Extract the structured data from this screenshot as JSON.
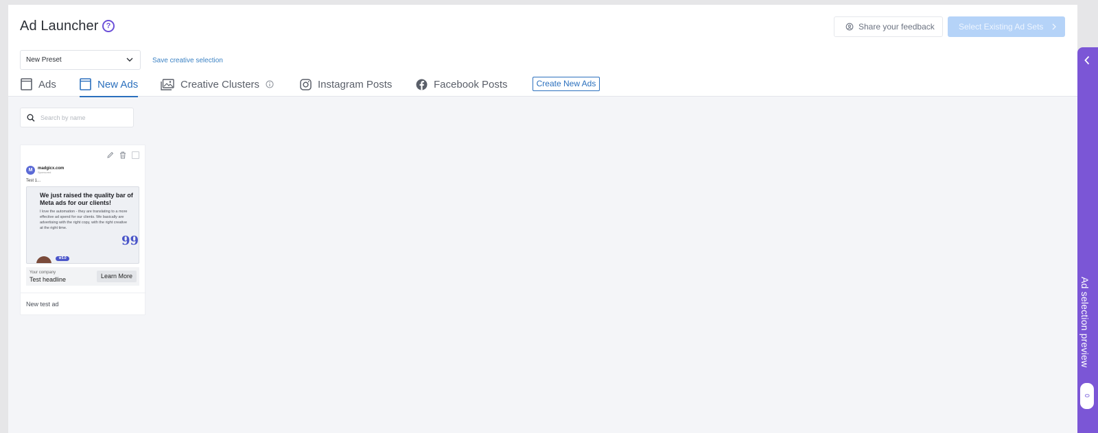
{
  "header": {
    "title": "Ad Launcher",
    "help_glyph": "?",
    "feedback_label": "Share your feedback",
    "select_label": "Select Existing Ad Sets"
  },
  "toolbar": {
    "preset_value": "New Preset",
    "save_link": "Save creative selection"
  },
  "tabs": [
    {
      "label": "Ads",
      "icon": "page-icon",
      "active": false
    },
    {
      "label": "New Ads",
      "icon": "page-icon",
      "active": true
    },
    {
      "label": "Creative Clusters",
      "icon": "image-gallery-icon",
      "active": false
    },
    {
      "label": "Instagram Posts",
      "icon": "instagram-icon",
      "active": false
    },
    {
      "label": "Facebook Posts",
      "icon": "facebook-icon",
      "active": false
    }
  ],
  "create_button": "Create New Ads",
  "search": {
    "placeholder": "Search by name"
  },
  "card": {
    "brand_logo": "M",
    "brand_name": "madgicx.com",
    "brand_sub": "Sponsored",
    "ad_text": "Test 1...",
    "creative_headline": "We just raised the quality bar of Meta ads for our clients!",
    "creative_body": "I love the automation - they are translating to a more effective ad spend for our clients. We basically are advertising with the right copy, with the right creative at the right time.",
    "creative_quote": "99",
    "creative_badge": "★5.0",
    "cta_company": "Your company",
    "cta_headline": "Test headline",
    "cta_button": "Learn More",
    "name": "New test ad"
  },
  "side_panel": {
    "title": "Ad selection preview",
    "count": "0"
  },
  "colors": {
    "accent_blue": "#2a6fbd",
    "purple": "#7b56d6",
    "disabled_button": "#b5d3f8"
  }
}
